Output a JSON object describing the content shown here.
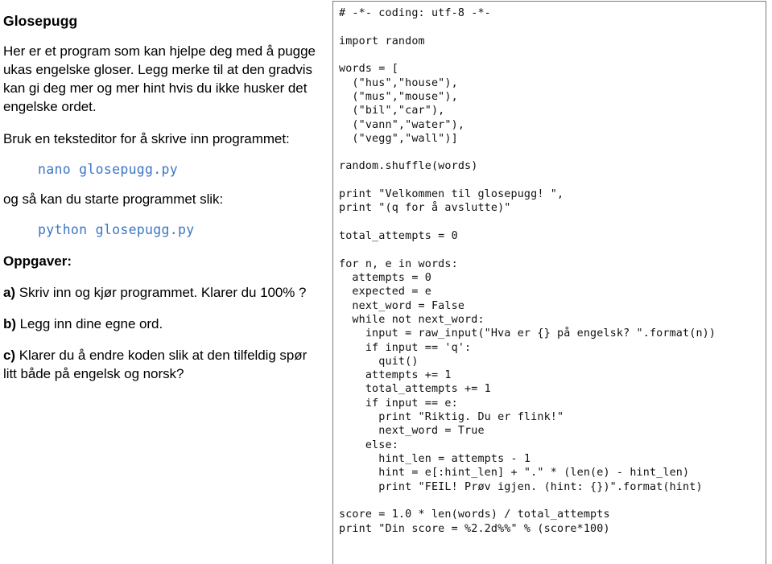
{
  "doc": {
    "title": "Glosepugg",
    "intro": "Her er et program som kan hjelpe deg med å pugge ukas engelske gloser. Legg merke til at den gradvis kan gi deg mer og mer hint hvis du ikke husker det engelske ordet.",
    "editor_instruction": "Bruk en teksteditor for å skrive inn programmet:",
    "editor_command": "nano glosepugg.py",
    "run_instruction": "og så kan du starte programmet slik:",
    "run_command": "python glosepugg.py",
    "tasks_heading": "Oppgaver:",
    "tasks": [
      {
        "marker": "a)",
        "text": " Skriv inn og kjør programmet. Klarer du 100% ?"
      },
      {
        "marker": "b)",
        "text": " Legg inn dine egne ord."
      },
      {
        "marker": "c)",
        "text": " Klarer du å endre koden slik at den tilfeldig spør litt både på engelsk og norsk?"
      }
    ]
  },
  "code_panel": {
    "source": "# -*- coding: utf-8 -*-\n\nimport random\n\nwords = [\n  (\"hus\",\"house\"),\n  (\"mus\",\"mouse\"),\n  (\"bil\",\"car\"),\n  (\"vann\",\"water\"),\n  (\"vegg\",\"wall\")]\n\nrandom.shuffle(words)\n\nprint \"Velkommen til glosepugg! \",\nprint \"(q for å avslutte)\"\n\ntotal_attempts = 0\n\nfor n, e in words:\n  attempts = 0\n  expected = e\n  next_word = False\n  while not next_word:\n    input = raw_input(\"Hva er {} på engelsk? \".format(n))\n    if input == 'q':\n      quit()\n    attempts += 1\n    total_attempts += 1\n    if input == e:\n      print \"Riktig. Du er flink!\"\n      next_word = True\n    else:\n      hint_len = attempts - 1\n      hint = e[:hint_len] + \".\" * (len(e) - hint_len)\n      print \"FEIL! Prøv igjen. (hint: {})\".format(hint)\n\nscore = 1.0 * len(words) / total_attempts\nprint \"Din score = %2.2d%%\" % (score*100)"
  },
  "colors": {
    "command_blue": "#3c76c6",
    "panel_border": "#7a7a7a",
    "text": "#000000",
    "background": "#ffffff"
  }
}
